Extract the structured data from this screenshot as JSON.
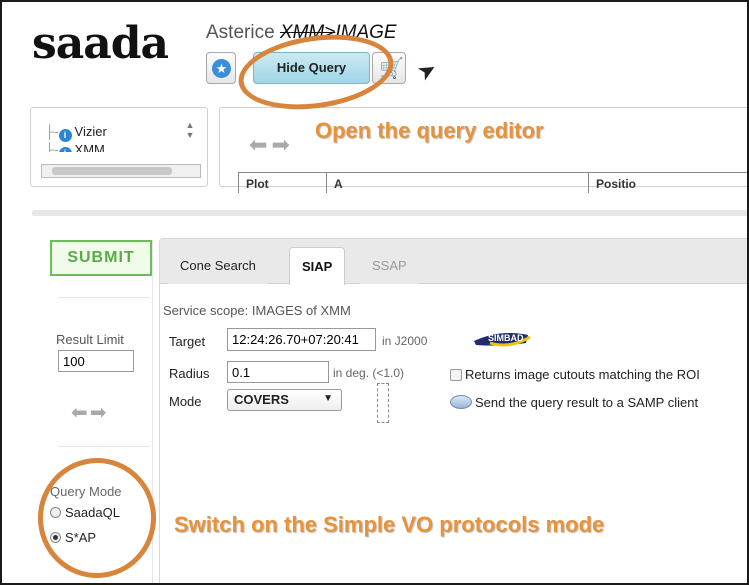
{
  "header": {
    "logo_text": "saada",
    "path_prefix": "Asterice ",
    "path_strike": "XMM>",
    "path_rest": "IMAGE",
    "hide_query_label": "Hide Query"
  },
  "tree": {
    "items": [
      {
        "label": "Vizier"
      },
      {
        "label": "XMM"
      }
    ]
  },
  "results": {
    "columns": [
      "Plot",
      "A",
      "Positio"
    ]
  },
  "annotations": {
    "open_editor": "Open the query editor",
    "switch_mode": "Switch on the Simple VO protocols mode",
    "color": "#d8843a"
  },
  "left_panel": {
    "submit_label": "SUBMIT",
    "result_limit_label": "Result Limit",
    "result_limit_value": "100",
    "query_mode_label": "Query Mode",
    "modes": [
      {
        "label": "SaadaQL",
        "selected": false
      },
      {
        "label": "S*AP",
        "selected": true
      }
    ]
  },
  "tabs": [
    {
      "label": "Cone Search",
      "active": false
    },
    {
      "label": "SIAP",
      "active": true
    },
    {
      "label": "SSAP",
      "active": false
    }
  ],
  "siap": {
    "scope": "Service scope: IMAGES of XMM",
    "target_label": "Target",
    "target_value": "12:24:26.70+07:20:41",
    "target_unit": "in J2000",
    "simbad_logo": "SIMBAD",
    "radius_label": "Radius",
    "radius_value": "0.1",
    "radius_unit": "in deg. (<1.0)",
    "mode_label": "Mode",
    "mode_value": "COVERS",
    "cutouts_label": "Returns image cutouts matching the ROI",
    "samp_label": "Send the query result to a SAMP client"
  }
}
